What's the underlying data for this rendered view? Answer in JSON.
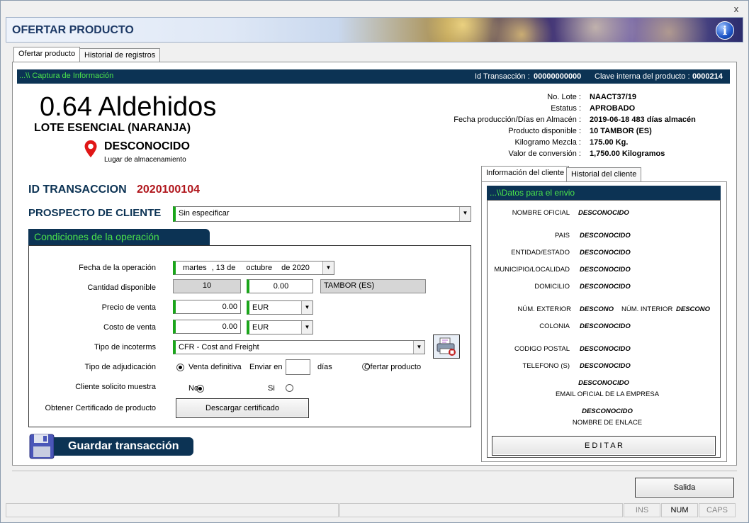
{
  "window": {
    "title": "OFERTAR PRODUCTO",
    "close_glyph": "x"
  },
  "tabs": [
    {
      "label": "Ofertar producto",
      "active": true
    },
    {
      "label": "Historial de registros",
      "active": false
    }
  ],
  "info_header": {
    "section": "...\\\\ Captura de Información",
    "id_transaccion_label": "Id Transacción :",
    "id_transaccion_value": "00000000000",
    "clave_label": "Clave interna del producto :",
    "clave_value": "0000214"
  },
  "product": {
    "name": "0.64 Aldehidos",
    "subtitle": "LOTE ESENCIAL (NARANJA)",
    "location": "DESCONOCIDO",
    "location_caption": "Lugar de almacenamiento"
  },
  "details": [
    {
      "label": "No. Lote :",
      "value": "NAACT37/19"
    },
    {
      "label": "Estatus :",
      "value": "APROBADO"
    },
    {
      "label": "Fecha producción/Días en Almacén :",
      "value": "2019-06-18  483 días almacén"
    },
    {
      "label": "Producto disponible :",
      "value": "10 TAMBOR (ES)"
    },
    {
      "label": "Kilogramo Mezcla :",
      "value": "175.00 Kg."
    },
    {
      "label": "Valor de conversión :",
      "value": "1,750.00 Kilogramos"
    }
  ],
  "transaccion": {
    "label": "ID TRANSACCION",
    "value": "2020100104"
  },
  "prospecto": {
    "label": "PROSPECTO DE CLIENTE",
    "value": "Sin especificar"
  },
  "condiciones": {
    "title": "Condiciones de la operación",
    "fecha_label": "Fecha de la operación",
    "fecha_dia": "martes",
    "fecha_num": ", 13 de",
    "fecha_mes": "octubre",
    "fecha_anio": "de 2020",
    "cantidad_label": "Cantidad disponible",
    "cantidad_disponible": "10",
    "cantidad_input": "0.00",
    "unidad": "TAMBOR (ES)",
    "precio_label": "Precio de venta",
    "precio_value": "0.00",
    "precio_moneda": "EUR",
    "costo_label": "Costo de venta",
    "costo_value": "0.00",
    "costo_moneda": "EUR",
    "incoterms_label": "Tipo de incoterms",
    "incoterms_value": "CFR - Cost and Freight",
    "adjudicacion_label": "Tipo de adjudicación",
    "venta_definitiva": "Venta definitiva",
    "enviar_en": "Enviar en",
    "enviar_dias_value": "",
    "dias": "días",
    "ofertar_producto": "Ofertar producto",
    "muestra_label": "Cliente solicito muestra",
    "muestra_no": "No",
    "muestra_si": "Si",
    "certificado_label": "Obtener Certificado de producto",
    "certificado_button": "Descargar certificado"
  },
  "guardar": {
    "label": "Guardar transacción"
  },
  "client_tabs": [
    {
      "label": "Información del cliente",
      "active": true
    },
    {
      "label": "Historial del cliente",
      "active": false
    }
  ],
  "client": {
    "header": "...\\\\Datos para el envio",
    "nombre_label": "NOMBRE OFICIAL",
    "nombre_value": "DESCONOCIDO",
    "pais_label": "PAIS",
    "pais_value": "DESCONOCIDO",
    "entidad_label": "ENTIDAD/ESTADO",
    "entidad_value": "DESCONOCIDO",
    "municipio_label": "MUNICIPIO/LOCALIDAD",
    "municipio_value": "DESCONOCIDO",
    "domicilio_label": "DOMICILIO",
    "domicilio_value": "DESCONOCIDO",
    "num_ext_label": "NÚM. EXTERIOR",
    "num_ext_value": "DESCONO",
    "num_int_label": "NÚM. INTERIOR",
    "num_int_value": "DESCONO",
    "colonia_label": "COLONIA",
    "colonia_value": "DESCONOCIDO",
    "cp_label": "CODIGO POSTAL",
    "cp_value": "DESCONOCIDO",
    "telefono_label": "TELEFONO (S)",
    "telefono_value": "DESCONOCIDO",
    "email_value": "DESCONOCIDO",
    "email_label": "EMAIL OFICIAL DE LA EMPRESA",
    "enlace_value": "DESCONOCIDO",
    "enlace_label": "NOMBRE DE ENLACE",
    "editar_button": "E D I T A R"
  },
  "salida_button": "Salida",
  "statusbar": {
    "ins": "INS",
    "num": "NUM",
    "caps": "CAPS"
  },
  "icons": {
    "info": "info-icon",
    "location": "map-pin-icon",
    "save": "floppy-disk-icon",
    "dropdown": "chevron-down-icon",
    "print": "printer-icon"
  },
  "colors": {
    "dark_header": "#0c3354",
    "accent_green": "#1aa51a",
    "transaction_red": "#b0161c",
    "section_title_green": "#4be44b",
    "title_blue": "#1e3a66"
  }
}
